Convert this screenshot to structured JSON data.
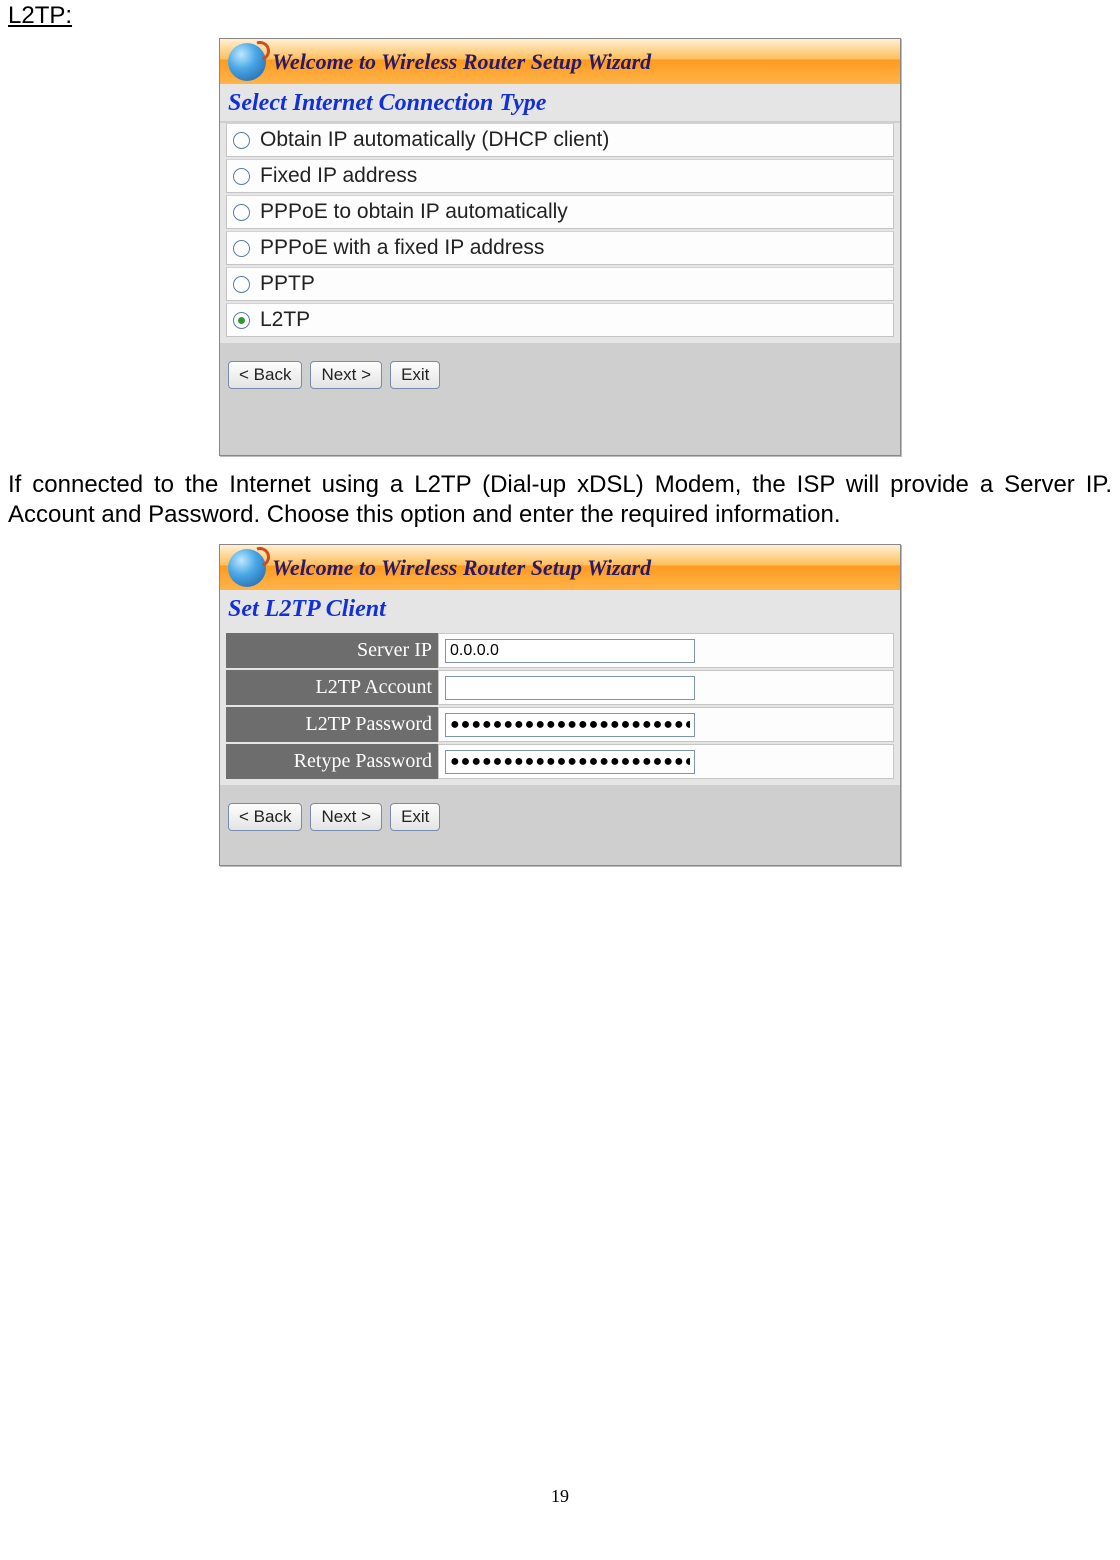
{
  "heading": "L2TP:",
  "wizard_title": "Welcome to Wireless Router Setup Wizard",
  "panel1": {
    "subheader": "Select Internet Connection Type",
    "options": [
      {
        "label": "Obtain IP automatically (DHCP client)",
        "selected": false
      },
      {
        "label": "Fixed IP address",
        "selected": false
      },
      {
        "label": "PPPoE to obtain IP automatically",
        "selected": false
      },
      {
        "label": "PPPoE with a fixed IP address",
        "selected": false
      },
      {
        "label": "PPTP",
        "selected": false
      },
      {
        "label": "L2TP",
        "selected": true
      }
    ]
  },
  "buttons": {
    "back": "< Back",
    "next": "Next >",
    "exit": "Exit"
  },
  "body_text": "If connected to the Internet using a L2TP (Dial-up xDSL) Modem, the ISP will provide a Server IP. Account and Password. Choose this option and enter the required information.",
  "panel2": {
    "subheader": "Set L2TP Client",
    "fields": {
      "server_ip_label": "Server IP",
      "server_ip_value": "0.0.0.0",
      "account_label": "L2TP Account",
      "account_value": "",
      "password_label": "L2TP Password",
      "password_value": "●●●●●●●●●●●●●●●●●●●●●●●●",
      "retype_label": "Retype Password",
      "retype_value": "●●●●●●●●●●●●●●●●●●●●●●●●"
    }
  },
  "page_number": "19"
}
